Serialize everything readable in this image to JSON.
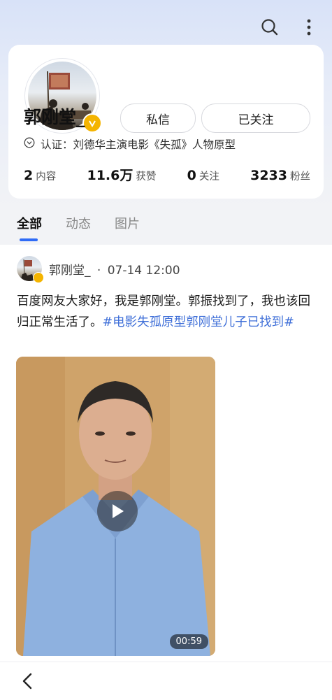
{
  "header": {
    "search_icon": "search-icon",
    "more_icon": "more-vertical-icon"
  },
  "profile": {
    "name": "郭刚堂_",
    "message_button": "私信",
    "follow_button": "已关注",
    "certification": "认证：刘德华主演电影《失孤》人物原型",
    "stats": [
      {
        "value": "2",
        "label": "内容"
      },
      {
        "value": "11.6万",
        "label": "获赞"
      },
      {
        "value": "0",
        "label": "关注"
      },
      {
        "value": "3233",
        "label": "粉丝"
      }
    ]
  },
  "tabs": [
    {
      "label": "全部",
      "active": true
    },
    {
      "label": "动态",
      "active": false
    },
    {
      "label": "图片",
      "active": false
    }
  ],
  "post": {
    "author": "郭刚堂_",
    "separator": "·",
    "time": "07-14 12:00",
    "text": "百度网友大家好，我是郭刚堂。郭振找到了，我也该回归正常生活了。",
    "hashtag": "#电影失孤原型郭刚堂儿子已找到#",
    "video_duration": "00:59"
  },
  "colors": {
    "accent": "#2f6bf6",
    "hashtag": "#3f6fd8",
    "verified": "#f4b400"
  }
}
